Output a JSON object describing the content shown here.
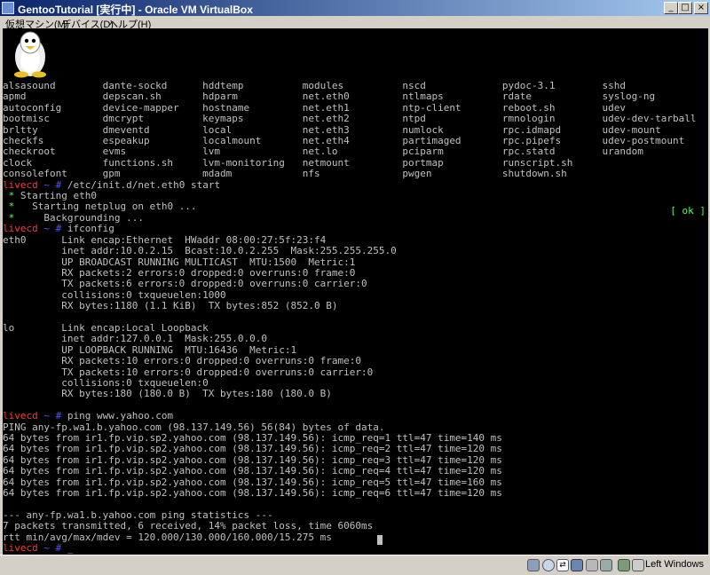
{
  "window": {
    "title": "GentooTutorial [実行中] - Oracle VM VirtualBox"
  },
  "menu": {
    "items": [
      "仮想マシン(M)",
      "デバイス(D)",
      "ヘルプ(H)"
    ]
  },
  "console": {
    "ok_status": "[ ok ]",
    "lines": [
      [
        {
          "t": "alsasound        dante-sockd      hddtemp          modules          nscd             pydoc-3.1        sshd"
        }
      ],
      [
        {
          "t": "apmd             depscan.sh       hdparm           net.eth0         ntlmaps          rdate            syslog-ng"
        }
      ],
      [
        {
          "t": "autoconfig       device-mapper    hostname         net.eth1         ntp-client       reboot.sh        udev"
        }
      ],
      [
        {
          "t": "bootmisc         dmcrypt          keymaps          net.eth2         ntpd             rmnologin        udev-dev-tarball"
        }
      ],
      [
        {
          "t": "brltty           dmeventd         local            net.eth3         numlock          rpc.idmapd       udev-mount"
        }
      ],
      [
        {
          "t": "checkfs          espeakup         localmount       net.eth4         partimaged       rpc.pipefs       udev-postmount"
        }
      ],
      [
        {
          "t": "checkroot        evms             lvm              net.lo           pciparm          rpc.statd        urandom"
        }
      ],
      [
        {
          "t": "clock            functions.sh     lvm-monitoring   netmount         portmap          runscript.sh"
        }
      ],
      [
        {
          "t": "consolefont      gpm              mdadm            nfs              pwgen            shutdown.sh"
        }
      ],
      [
        {
          "t": "livecd",
          "c": "red"
        },
        {
          "t": " ~ # ",
          "c": "blu"
        },
        {
          "t": "/etc/init.d/net.eth0 start"
        }
      ],
      [
        {
          "t": " * ",
          "c": "grn"
        },
        {
          "t": "Starting eth0"
        }
      ],
      [
        {
          "t": " *   ",
          "c": "grn"
        },
        {
          "t": "Starting netplug on eth0 ..."
        }
      ],
      [
        {
          "t": " *     ",
          "c": "grn"
        },
        {
          "t": "Backgrounding ..."
        }
      ],
      [
        {
          "t": "livecd",
          "c": "red"
        },
        {
          "t": " ~ # ",
          "c": "blu"
        },
        {
          "t": "ifconfig"
        }
      ],
      [
        {
          "t": "eth0      Link encap:Ethernet  HWaddr 08:00:27:5f:23:f4"
        }
      ],
      [
        {
          "t": "          inet addr:10.0.2.15  Bcast:10.0.2.255  Mask:255.255.255.0"
        }
      ],
      [
        {
          "t": "          UP BROADCAST RUNNING MULTICAST  MTU:1500  Metric:1"
        }
      ],
      [
        {
          "t": "          RX packets:2 errors:0 dropped:0 overruns:0 frame:0"
        }
      ],
      [
        {
          "t": "          TX packets:6 errors:0 dropped:0 overruns:0 carrier:0"
        }
      ],
      [
        {
          "t": "          collisions:0 txqueuelen:1000"
        }
      ],
      [
        {
          "t": "          RX bytes:1180 (1.1 KiB)  TX bytes:852 (852.0 B)"
        }
      ],
      [
        {
          "t": ""
        }
      ],
      [
        {
          "t": "lo        Link encap:Local Loopback"
        }
      ],
      [
        {
          "t": "          inet addr:127.0.0.1  Mask:255.0.0.0"
        }
      ],
      [
        {
          "t": "          UP LOOPBACK RUNNING  MTU:16436  Metric:1"
        }
      ],
      [
        {
          "t": "          RX packets:10 errors:0 dropped:0 overruns:0 frame:0"
        }
      ],
      [
        {
          "t": "          TX packets:10 errors:0 dropped:0 overruns:0 carrier:0"
        }
      ],
      [
        {
          "t": "          collisions:0 txqueuelen:0"
        }
      ],
      [
        {
          "t": "          RX bytes:180 (180.0 B)  TX bytes:180 (180.0 B)"
        }
      ],
      [
        {
          "t": ""
        }
      ],
      [
        {
          "t": "livecd",
          "c": "red"
        },
        {
          "t": " ~ # ",
          "c": "blu"
        },
        {
          "t": "ping www.yahoo.com"
        }
      ],
      [
        {
          "t": "PING any-fp.wa1.b.yahoo.com (98.137.149.56) 56(84) bytes of data."
        }
      ],
      [
        {
          "t": "64 bytes from ir1.fp.vip.sp2.yahoo.com (98.137.149.56): icmp_req=1 ttl=47 time=140 ms"
        }
      ],
      [
        {
          "t": "64 bytes from ir1.fp.vip.sp2.yahoo.com (98.137.149.56): icmp_req=2 ttl=47 time=120 ms"
        }
      ],
      [
        {
          "t": "64 bytes from ir1.fp.vip.sp2.yahoo.com (98.137.149.56): icmp_req=3 ttl=47 time=120 ms"
        }
      ],
      [
        {
          "t": "64 bytes from ir1.fp.vip.sp2.yahoo.com (98.137.149.56): icmp_req=4 ttl=47 time=120 ms"
        }
      ],
      [
        {
          "t": "64 bytes from ir1.fp.vip.sp2.yahoo.com (98.137.149.56): icmp_req=5 ttl=47 time=160 ms"
        }
      ],
      [
        {
          "t": "64 bytes from ir1.fp.vip.sp2.yahoo.com (98.137.149.56): icmp_req=6 ttl=47 time=120 ms"
        }
      ],
      [
        {
          "t": ""
        }
      ],
      [
        {
          "t": "--- any-fp.wa1.b.yahoo.com ping statistics ---"
        }
      ],
      [
        {
          "t": "7 packets transmitted, 6 received, 14% packet loss, time 6060ms"
        }
      ],
      [
        {
          "t": "rtt min/avg/max/mdev = 120.000/130.000/160.000/15.275 ms"
        }
      ],
      [
        {
          "t": "livecd",
          "c": "red"
        },
        {
          "t": " ~ # ",
          "c": "blu"
        },
        {
          "t": "_"
        }
      ]
    ]
  },
  "statusbar": {
    "icons": [
      "hdd-icon",
      "optical-drive-icon",
      "usb-icon",
      "network-icon",
      "shared-folder-icon",
      "display-icon",
      "capture-icon",
      "mouse-integration-icon",
      "keyboard-icon"
    ],
    "host_key": "Left Windows"
  }
}
